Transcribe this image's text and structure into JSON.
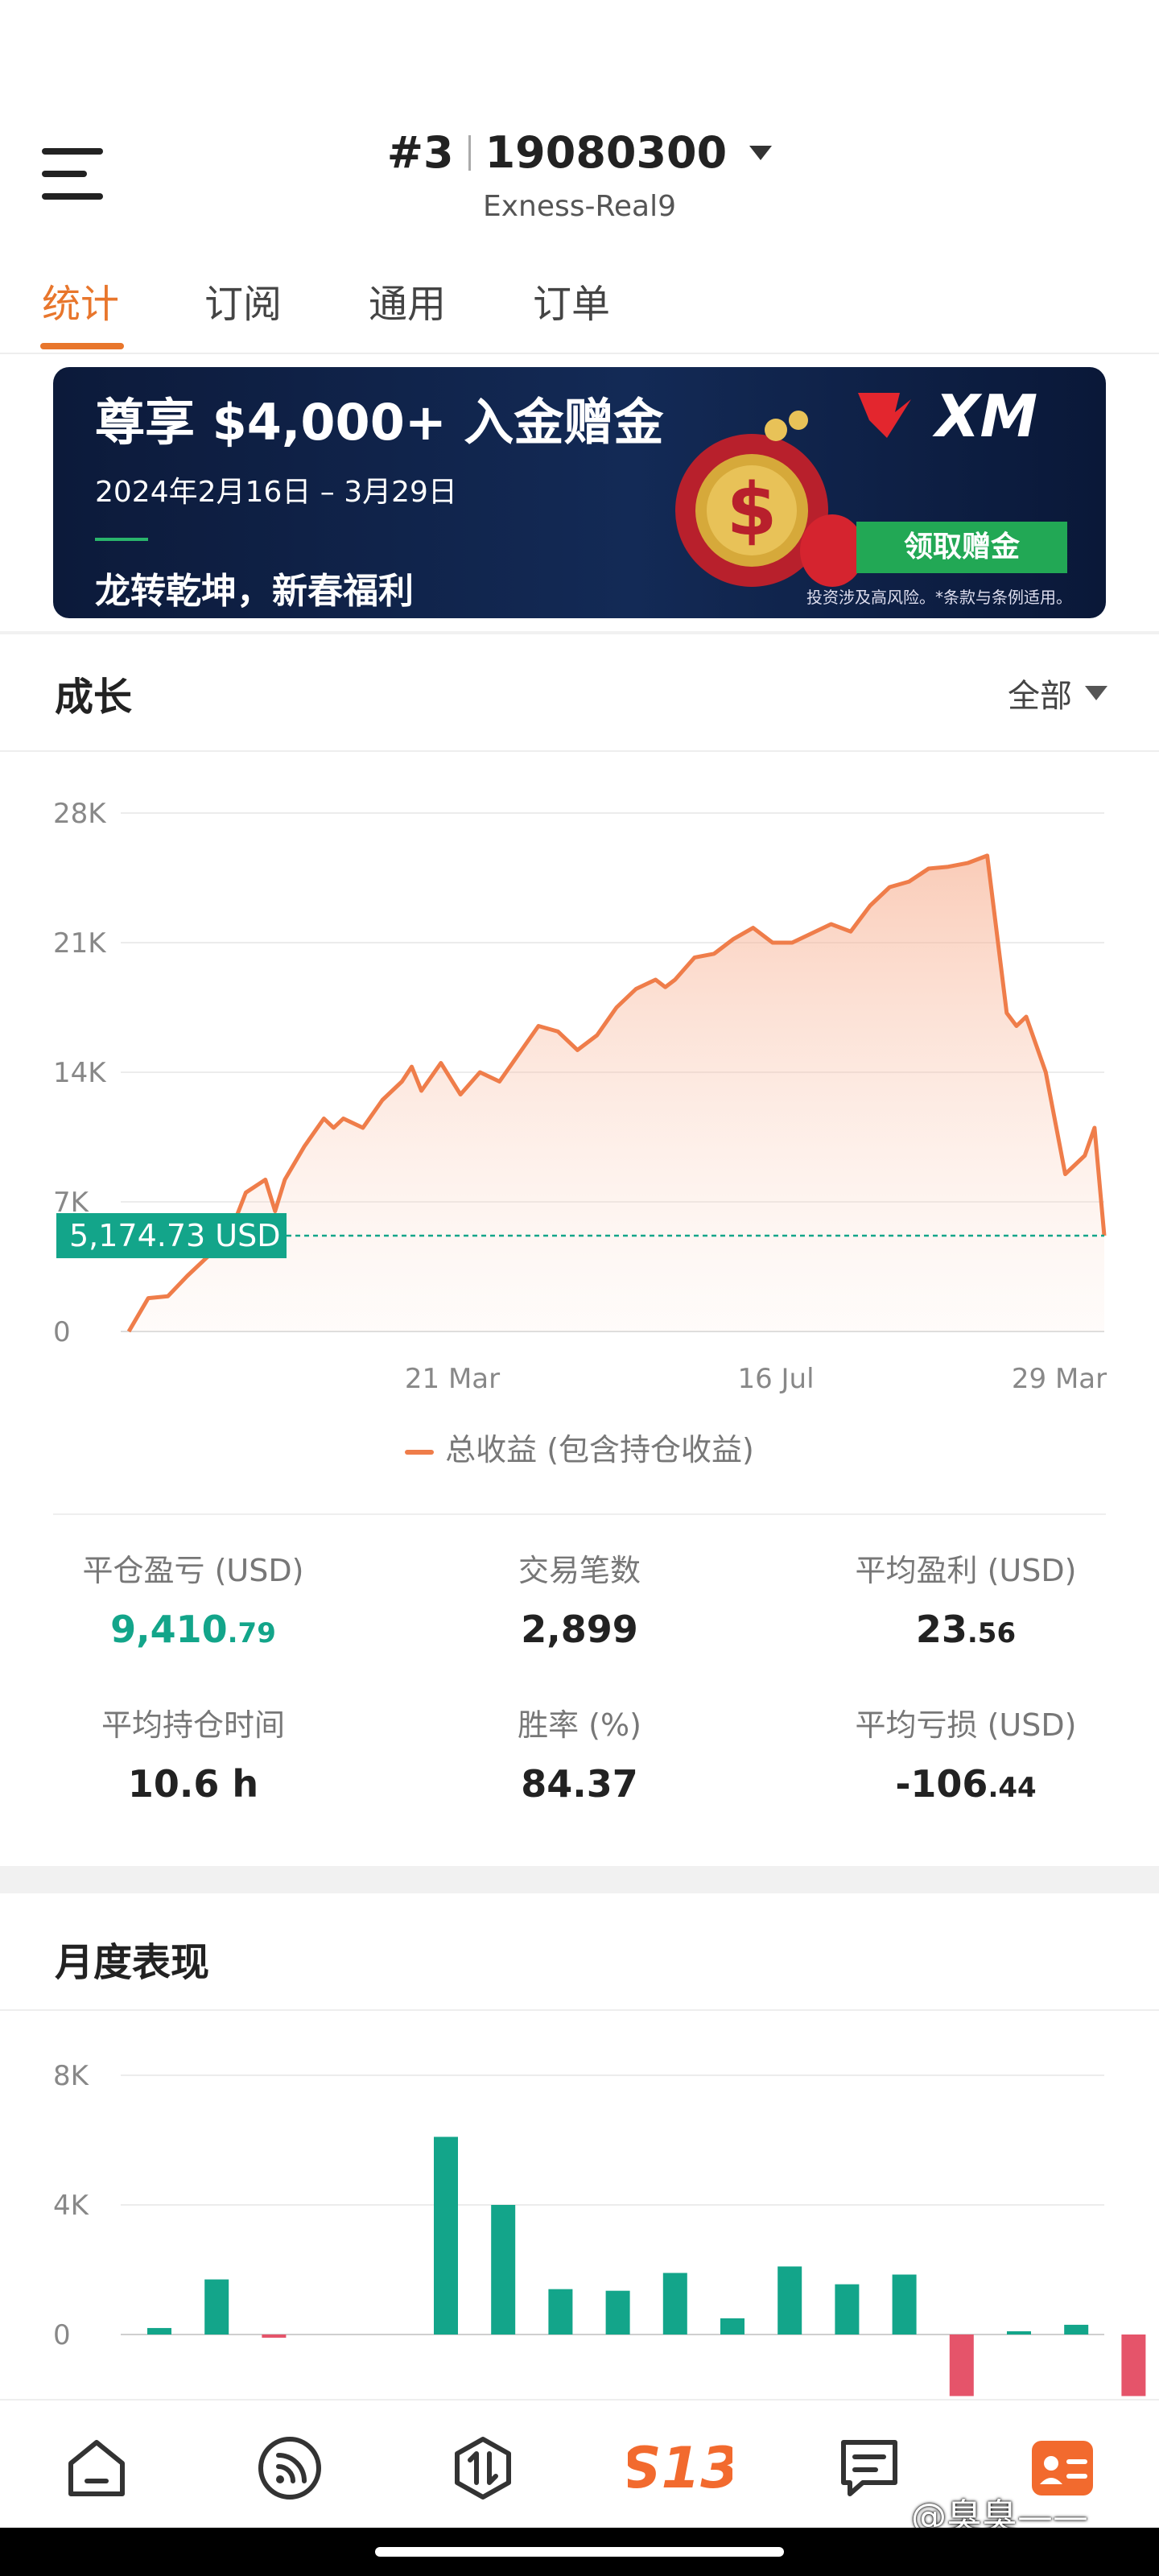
{
  "header": {
    "account_number": "#3",
    "account_id": "19080300",
    "server": "Exness-Real9"
  },
  "tabs": [
    {
      "label": "统计",
      "active": true
    },
    {
      "label": "订阅",
      "active": false
    },
    {
      "label": "通用",
      "active": false
    },
    {
      "label": "订单",
      "active": false
    }
  ],
  "banner": {
    "title": "尊享 $4,000+ 入金赠金",
    "date": "2024年2月16日 – 3月29日",
    "subtitle": "龙转乾坤，新春福利",
    "brand": "XM",
    "button": "领取赠金",
    "risk_note": "投资涉及高风险。*条款与条例适用。"
  },
  "growth": {
    "title": "成长",
    "filter": "全部",
    "current_label": "5,174.73 USD",
    "legend": "总收益 (包含持仓收益)"
  },
  "chart_data": [
    {
      "type": "area",
      "y_ticks": [
        "28K",
        "21K",
        "14K",
        "7K",
        "0"
      ],
      "x_ticks": [
        "21 Mar",
        "16 Jul",
        "29 Mar"
      ],
      "ylim": [
        0,
        28000
      ],
      "reference_value": 5174.73,
      "series": [
        {
          "name": "总收益 (包含持仓收益)",
          "x": [
            0,
            2,
            4,
            6,
            8,
            10,
            12,
            14,
            15,
            16,
            18,
            20,
            21,
            22,
            24,
            26,
            28,
            29,
            30,
            32,
            34,
            36,
            38,
            40,
            42,
            44,
            46,
            48,
            50,
            52,
            54,
            55,
            56,
            58,
            60,
            62,
            64,
            66,
            68,
            70,
            72,
            74,
            76,
            78,
            80,
            82,
            84,
            86,
            88,
            90,
            91,
            92,
            94,
            96,
            98,
            99,
            100
          ],
          "values": [
            0,
            1800,
            1900,
            3000,
            4000,
            4800,
            7500,
            8200,
            6500,
            8200,
            10000,
            11500,
            11000,
            11500,
            11000,
            12500,
            13500,
            14300,
            13000,
            14500,
            12800,
            14000,
            13500,
            15000,
            16500,
            16200,
            15200,
            16000,
            17500,
            18500,
            19000,
            18600,
            19000,
            20200,
            20400,
            21200,
            21800,
            21000,
            21000,
            21500,
            22000,
            21600,
            23000,
            24000,
            24300,
            25000,
            25100,
            25300,
            25700,
            17200,
            16500,
            17000,
            14000,
            8500,
            9500,
            11000,
            5174.73
          ]
        }
      ],
      "grid": true
    },
    {
      "type": "bar",
      "title": "月度表现",
      "y_ticks": [
        "8K",
        "4K",
        "0"
      ],
      "ylim": [
        -2000,
        8000
      ],
      "values": [
        200,
        1700,
        -50,
        0,
        0,
        6100,
        4000,
        1400,
        1350,
        1900,
        500,
        2100,
        1550,
        1850,
        -1900,
        50,
        300,
        -1900
      ],
      "colors": {
        "positive": "#13a58a",
        "negative": "#e5546a"
      }
    }
  ],
  "stats": [
    {
      "label": "平仓盈亏 (USD)",
      "int": "9,410",
      "dec": ".79",
      "green": true
    },
    {
      "label": "交易笔数",
      "int": "2,899",
      "dec": "",
      "green": false
    },
    {
      "label": "平均盈利 (USD)",
      "int": "23",
      "dec": ".56",
      "green": false
    },
    {
      "label": "平均持仓时间",
      "int": "10.6 h",
      "dec": "",
      "green": false
    },
    {
      "label": "胜率 (%)",
      "int": "84.37",
      "dec": "",
      "green": false
    },
    {
      "label": "平均亏损 (USD)",
      "int": "-106",
      "dec": ".44",
      "green": false
    }
  ],
  "monthly": {
    "title": "月度表现"
  },
  "nav": [
    {
      "icon": "home-icon"
    },
    {
      "icon": "feed-icon"
    },
    {
      "icon": "trade-icon"
    },
    {
      "icon": "s13-logo-icon",
      "label": "S13"
    },
    {
      "icon": "message-icon"
    },
    {
      "icon": "profile-card-icon"
    }
  ],
  "watermark": "@臭臭——"
}
